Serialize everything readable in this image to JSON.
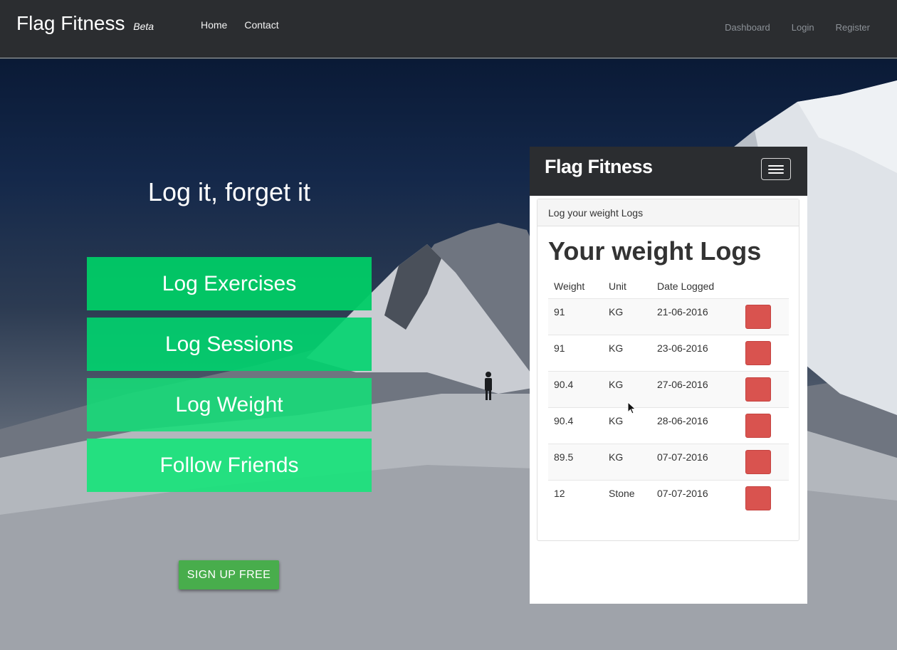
{
  "topbar": {
    "brand": "Flag Fitness",
    "brand_badge": "Beta",
    "nav_left": [
      "Home",
      "Contact"
    ],
    "nav_right": [
      "Dashboard",
      "Login",
      "Register"
    ]
  },
  "hero": {
    "headline": "Log it, forget it",
    "actions": [
      "Log Exercises",
      "Log Sessions",
      "Log Weight",
      "Follow Friends"
    ],
    "signup_label": "SIGN UP FREE"
  },
  "phone": {
    "brand": "Flag Fitness",
    "menu_icon": "hamburger-menu-icon",
    "panel_heading": "Log your weight Logs",
    "title": "Your weight Logs",
    "columns": [
      "Weight",
      "Unit",
      "Date Logged"
    ],
    "rows": [
      {
        "weight": "91",
        "unit": "KG",
        "date": "21-06-2016"
      },
      {
        "weight": "91",
        "unit": "KG",
        "date": "23-06-2016"
      },
      {
        "weight": "90.4",
        "unit": "KG",
        "date": "27-06-2016"
      },
      {
        "weight": "90.4",
        "unit": "KG",
        "date": "28-06-2016"
      },
      {
        "weight": "89.5",
        "unit": "KG",
        "date": "07-07-2016"
      },
      {
        "weight": "12",
        "unit": "Stone",
        "date": "07-07-2016"
      }
    ]
  },
  "colors": {
    "navbar": "#2b2d30",
    "cta_green": "#00cc66",
    "signup_green": "#48ad4c",
    "delete_red": "#d9534f"
  }
}
